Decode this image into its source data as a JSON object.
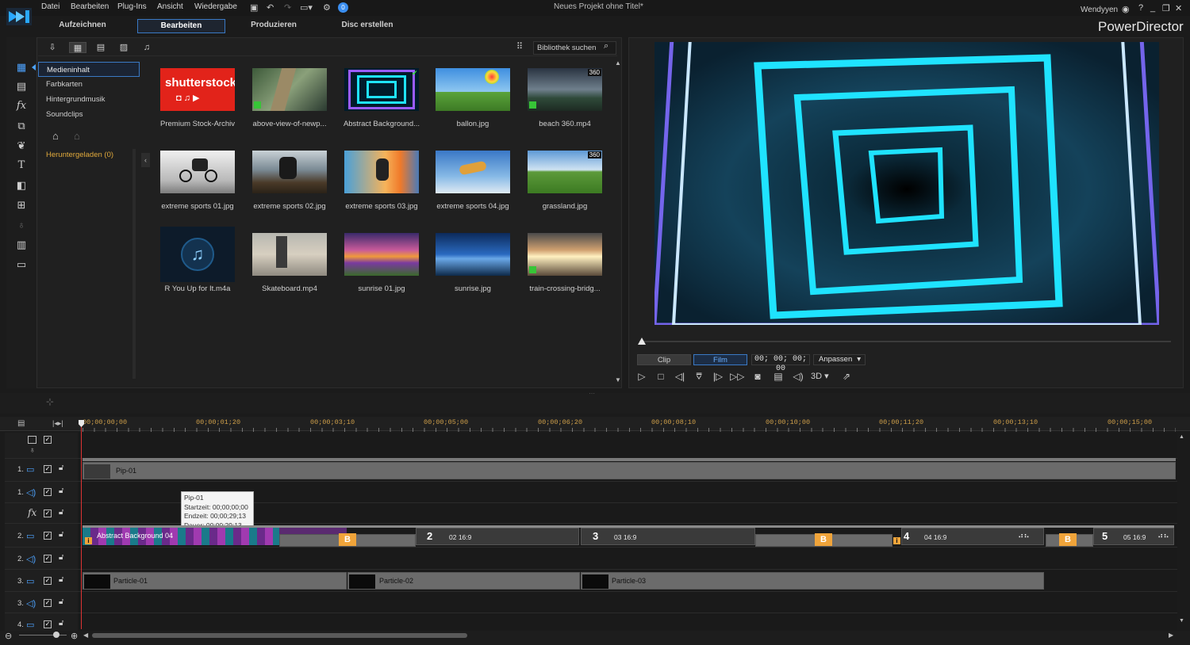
{
  "menu": [
    "Datei",
    "Bearbeiten",
    "Plug-Ins",
    "Ansicht",
    "Wiedergabe"
  ],
  "project_title": "Neues Projekt ohne Titel*",
  "user": "Wendyyen",
  "brand": "PowerDirector",
  "mode_tabs": [
    "Aufzeichnen",
    "Bearbeiten",
    "Produzieren",
    "Disc erstellen"
  ],
  "library": {
    "categories": [
      "Medieninhalt",
      "Farbkarten",
      "Hintergrundmusik",
      "Soundclips"
    ],
    "downloaded": "Heruntergeladen  (0)",
    "search_placeholder": "Bibliothek suchen",
    "items": [
      {
        "label": "Premium Stock-Archiv",
        "logo": "shutterstock"
      },
      {
        "label": "above-view-of-newp...",
        "badge": ""
      },
      {
        "label": "Abstract Background...",
        "badge": ""
      },
      {
        "label": "ballon.jpg",
        "badge": ""
      },
      {
        "label": "beach 360.mp4",
        "badge": "360"
      },
      {
        "label": "extreme sports 01.jpg",
        "badge": ""
      },
      {
        "label": "extreme sports 02.jpg",
        "badge": ""
      },
      {
        "label": "extreme sports 03.jpg",
        "badge": ""
      },
      {
        "label": "extreme sports 04.jpg",
        "badge": ""
      },
      {
        "label": "grassland.jpg",
        "badge": "360"
      },
      {
        "label": "R You Up for It.m4a",
        "badge": ""
      },
      {
        "label": "Skateboard.mp4",
        "badge": ""
      },
      {
        "label": "sunrise 01.jpg",
        "badge": ""
      },
      {
        "label": "sunrise.jpg",
        "badge": ""
      },
      {
        "label": "train-crossing-bridg...",
        "badge": ""
      }
    ]
  },
  "preview": {
    "clip_tab": "Clip",
    "film_tab": "Film",
    "timecode": "00; 00; 00; 00",
    "fit": "Anpassen",
    "mode_3d": "3D"
  },
  "timeline": {
    "ruler": [
      "00;00;00;00",
      "00;00;01;20",
      "00;00;03;10",
      "00;00;05;00",
      "00;00;06;20",
      "00;00;08;10",
      "00;00;10;00",
      "00;00;11;20",
      "00;00;13;10",
      "00;00;15;00"
    ],
    "tracks": [
      {
        "num": "1.",
        "type": "video"
      },
      {
        "num": "1.",
        "type": "audio"
      },
      {
        "num": "",
        "type": "fx"
      },
      {
        "num": "2.",
        "type": "video"
      },
      {
        "num": "2.",
        "type": "audio"
      },
      {
        "num": "3.",
        "type": "video"
      },
      {
        "num": "3.",
        "type": "audio"
      },
      {
        "num": "4.",
        "type": "video"
      }
    ],
    "clips": {
      "pip": "Pip-01",
      "abstract": "Abstract Background 04",
      "slide2": {
        "num": "2",
        "label": "02 16:9"
      },
      "slide3": {
        "num": "3",
        "label": "03 16:9"
      },
      "slide4": {
        "num": "4",
        "label": "04 16:9"
      },
      "slide5": {
        "num": "5",
        "label": "05 16:9"
      },
      "particle1": "Particle-01",
      "particle2": "Particle-02",
      "particle3": "Particle-03"
    },
    "tooltip": {
      "title": "Pip-01",
      "start": "Startzeit: 00;00;00;00",
      "end": "Endzeit: 00;00;29;13",
      "duration": "Dauer: 00;00;29;13"
    }
  },
  "colors": {
    "accent": "#3a79c4",
    "cyan": "#1fe3ff",
    "ruler_text": "#d0a04a",
    "transition": "#f0a43a"
  }
}
